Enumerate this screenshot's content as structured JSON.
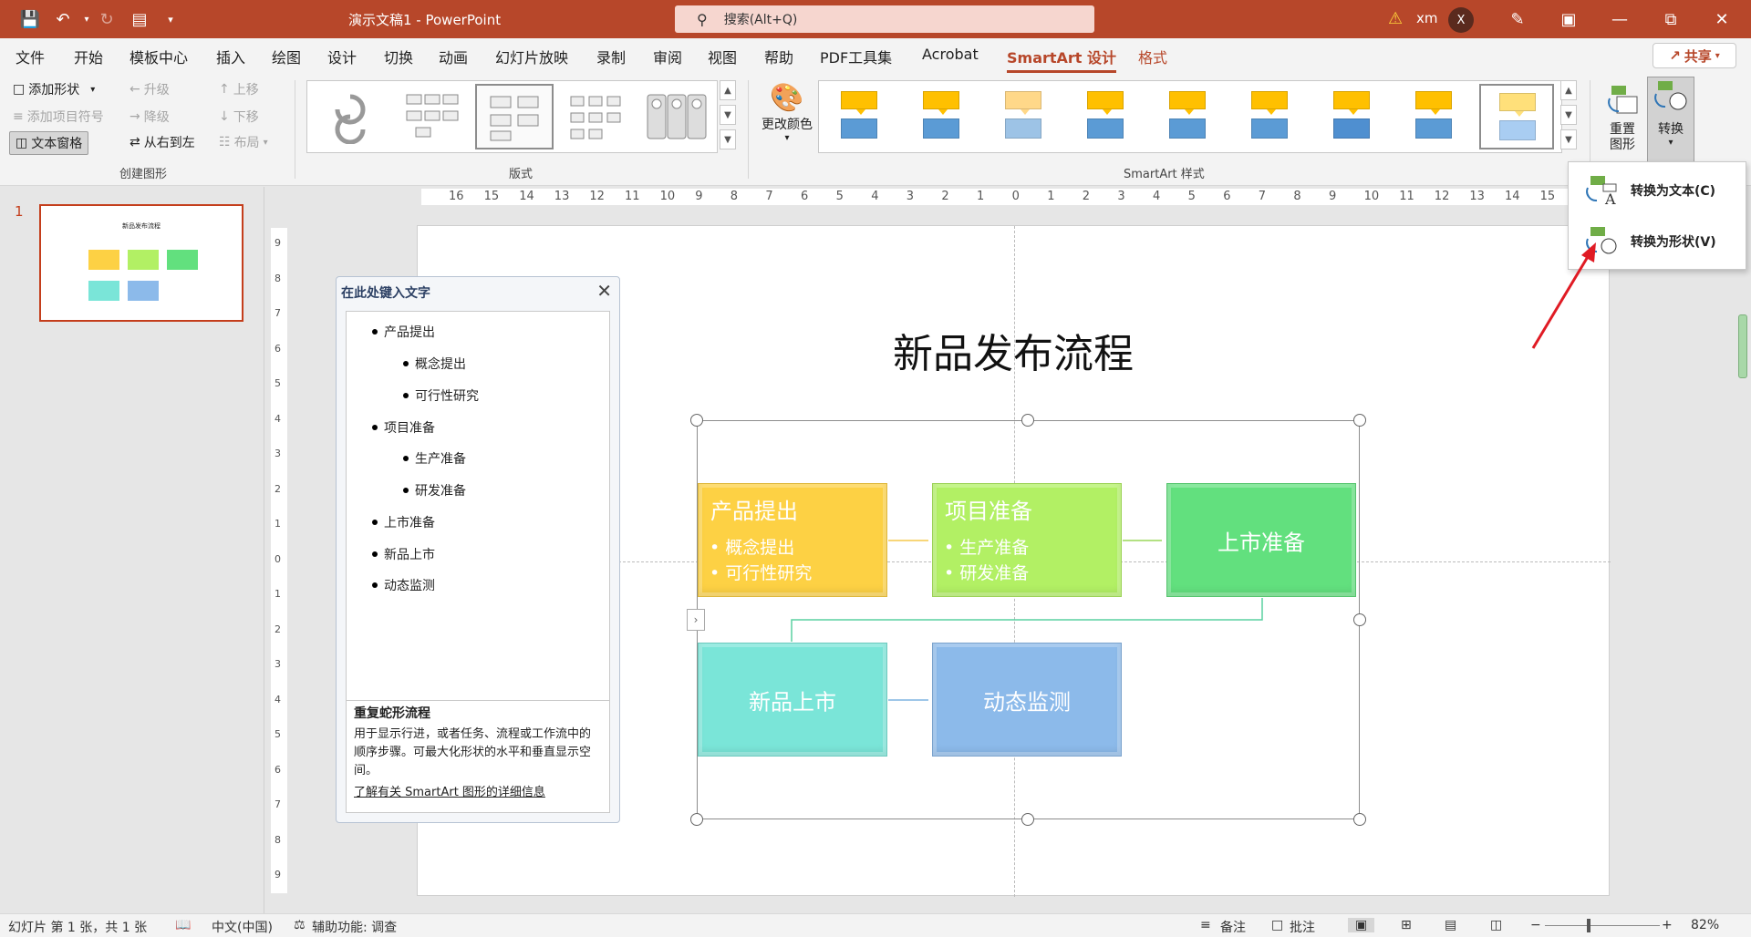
{
  "titlebar": {
    "doc_title": "演示文稿1 - PowerPoint",
    "search_placeholder": "搜索(Alt+Q)",
    "user_name": "xm",
    "avatar_initial": "X",
    "accent": "#b7472a"
  },
  "menu": {
    "tabs": [
      "文件",
      "开始",
      "模板中心",
      "插入",
      "绘图",
      "设计",
      "切换",
      "动画",
      "幻灯片放映",
      "录制",
      "审阅",
      "视图",
      "帮助",
      "PDF工具集",
      "Acrobat",
      "SmartArt 设计",
      "格式"
    ],
    "active_tab": "SmartArt 设计",
    "share": "共享"
  },
  "ribbon": {
    "create": {
      "add_shape": "添加形状",
      "add_bullet": "添加项目符号",
      "text_pane": "文本窗格",
      "promote": "升级",
      "demote": "降级",
      "right_to_left": "从右到左",
      "move_up": "上移",
      "move_down": "下移",
      "layout": "布局",
      "group_label": "创建图形"
    },
    "layouts_label": "版式",
    "change_colors": "更改颜色",
    "styles_label": "SmartArt 样式",
    "reset": "重置\n图形",
    "reset_l1": "重置",
    "reset_l2": "图形",
    "convert": "转换"
  },
  "convert_menu": {
    "to_text": "转换为文本(C)",
    "to_shapes": "转换为形状(V)"
  },
  "slide_panel": {
    "slide_number": "1",
    "thumb_title": "新品发布流程"
  },
  "slide": {
    "title": "新品发布流程",
    "boxes": [
      {
        "head": "产品提出",
        "items": [
          "• 概念提出",
          "• 可行性研究"
        ],
        "color": "#fdd144"
      },
      {
        "head": "项目准备",
        "items": [
          "• 生产准备",
          "• 研发准备"
        ],
        "color": "#b2f064"
      },
      {
        "head": "上市准备",
        "items": [],
        "color": "#62e07e"
      },
      {
        "head": "新品上市",
        "items": [],
        "color": "#7ae5d8"
      },
      {
        "head": "动态监测",
        "items": [],
        "color": "#8cbaea"
      }
    ]
  },
  "text_pane": {
    "title": "在此处键入文字",
    "items": [
      {
        "text": "产品提出",
        "level": 1
      },
      {
        "text": "概念提出",
        "level": 2
      },
      {
        "text": "可行性研究",
        "level": 2
      },
      {
        "text": "项目准备",
        "level": 1
      },
      {
        "text": "生产准备",
        "level": 2
      },
      {
        "text": "研发准备",
        "level": 2
      },
      {
        "text": "上市准备",
        "level": 1
      },
      {
        "text": "新品上市",
        "level": 1
      },
      {
        "text": "动态监测",
        "level": 1
      }
    ],
    "desc_title": "重复蛇形流程",
    "desc_body": "用于显示行进，或者任务、流程或工作流中的顺序步骤。可最大化形状的水平和垂直显示空间。",
    "desc_link": "了解有关 SmartArt 图形的详细信息"
  },
  "ruler": {
    "h_ticks": [
      "16",
      "15",
      "14",
      "13",
      "12",
      "11",
      "10",
      "9",
      "8",
      "7",
      "6",
      "5",
      "4",
      "3",
      "2",
      "1",
      "0",
      "1",
      "2",
      "3",
      "4",
      "5",
      "6",
      "7",
      "8",
      "9",
      "10",
      "11",
      "12",
      "13",
      "14",
      "15"
    ],
    "v_ticks": [
      "9",
      "8",
      "7",
      "6",
      "5",
      "4",
      "3",
      "2",
      "1",
      "0",
      "1",
      "2",
      "3",
      "4",
      "5",
      "6",
      "7",
      "8",
      "9"
    ]
  },
  "statusbar": {
    "slide_info": "幻灯片 第 1 张，共 1 张",
    "language": "中文(中国)",
    "accessibility": "辅助功能: 调查",
    "notes": "备注",
    "comments": "批注",
    "zoom": "82%"
  }
}
